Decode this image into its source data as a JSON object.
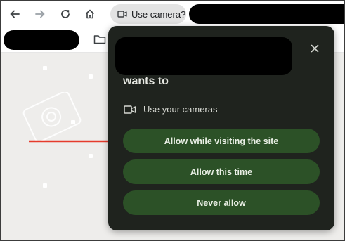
{
  "toolbar": {
    "back_icon": "arrow-left-icon",
    "forward_icon": "arrow-right-icon",
    "reload_icon": "reload-icon",
    "home_icon": "home-icon",
    "permission_chip_label": "Use camera?",
    "camera_icon": "camera-icon"
  },
  "bookmarks": {
    "folder_icon": "folder-icon"
  },
  "popup": {
    "heading": "wants to",
    "permission_label": "Use your cameras",
    "close_icon": "close-icon",
    "buttons": [
      {
        "label": "Allow while visiting the site"
      },
      {
        "label": "Allow this time"
      },
      {
        "label": "Never allow"
      }
    ]
  },
  "annotation": {
    "arrow_color": "#e53b2c"
  },
  "colors": {
    "popup_bg": "#1f231e",
    "button_bg": "#2c5127",
    "page_bg": "#eeedeb"
  }
}
